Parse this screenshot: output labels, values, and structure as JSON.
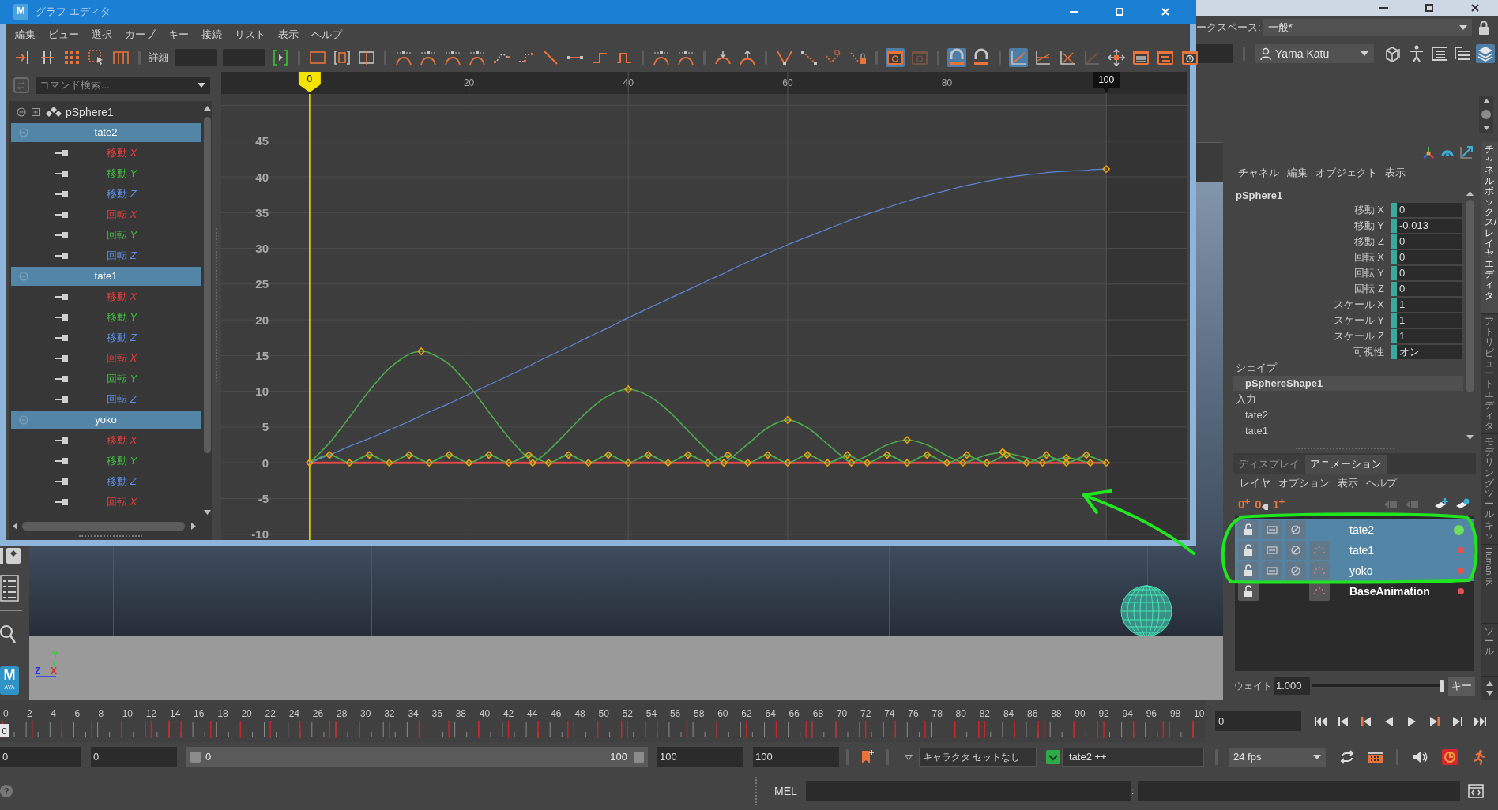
{
  "graph_editor": {
    "title": "グラフ エディタ",
    "icon_letter": "M",
    "menu": [
      "編集",
      "ビュー",
      "選択",
      "カーブ",
      "キー",
      "接続",
      "リスト",
      "表示",
      "ヘルプ"
    ],
    "toolbar": [
      {
        "kind": "icon",
        "on": false,
        "disabled": false
      },
      {
        "kind": "icon",
        "on": false,
        "disabled": false
      },
      {
        "kind": "icon",
        "on": false,
        "disabled": false
      },
      {
        "kind": "icon",
        "on": false,
        "disabled": false
      },
      {
        "kind": "icon",
        "on": false,
        "disabled": false
      },
      {
        "kind": "separator"
      },
      {
        "kind": "label",
        "text": "詳細"
      },
      {
        "kind": "field"
      },
      {
        "kind": "field"
      },
      {
        "kind": "icon",
        "on": false,
        "disabled": false
      },
      {
        "kind": "separator"
      },
      {
        "kind": "icon",
        "on": false,
        "disabled": false
      },
      {
        "kind": "icon",
        "on": false,
        "disabled": false
      },
      {
        "kind": "icon",
        "on": false,
        "disabled": false
      },
      {
        "kind": "separator"
      },
      {
        "kind": "icon",
        "on": false,
        "disabled": false
      },
      {
        "kind": "icon",
        "on": false,
        "disabled": false
      },
      {
        "kind": "icon",
        "on": false,
        "disabled": false
      },
      {
        "kind": "icon",
        "on": false,
        "disabled": false
      },
      {
        "kind": "icon",
        "on": false,
        "disabled": false
      },
      {
        "kind": "icon",
        "on": false,
        "disabled": false
      },
      {
        "kind": "icon",
        "on": false,
        "disabled": false
      },
      {
        "kind": "icon",
        "on": false,
        "disabled": false
      },
      {
        "kind": "icon",
        "on": false,
        "disabled": false
      },
      {
        "kind": "icon",
        "on": false,
        "disabled": false
      },
      {
        "kind": "separator"
      },
      {
        "kind": "icon",
        "on": false,
        "disabled": false
      },
      {
        "kind": "icon",
        "on": false,
        "disabled": false
      },
      {
        "kind": "separator"
      },
      {
        "kind": "icon",
        "on": false,
        "disabled": false
      },
      {
        "kind": "icon",
        "on": false,
        "disabled": false
      },
      {
        "kind": "separator"
      },
      {
        "kind": "icon",
        "on": false,
        "disabled": false
      },
      {
        "kind": "icon",
        "on": false,
        "disabled": false
      },
      {
        "kind": "icon",
        "on": false,
        "disabled": false
      },
      {
        "kind": "icon",
        "on": false,
        "disabled": false
      },
      {
        "kind": "separator"
      },
      {
        "kind": "icon",
        "on": true,
        "disabled": false
      },
      {
        "kind": "icon",
        "on": false,
        "disabled": true
      },
      {
        "kind": "separator"
      },
      {
        "kind": "icon",
        "on": true,
        "disabled": false
      },
      {
        "kind": "icon",
        "on": false,
        "disabled": false
      },
      {
        "kind": "separator"
      },
      {
        "kind": "icon",
        "on": true,
        "disabled": false
      },
      {
        "kind": "icon",
        "on": false,
        "disabled": false
      },
      {
        "kind": "icon",
        "on": false,
        "disabled": false
      },
      {
        "kind": "icon",
        "on": false,
        "disabled": true
      },
      {
        "kind": "icon",
        "on": false,
        "disabled": false
      },
      {
        "kind": "icon",
        "on": false,
        "disabled": false
      },
      {
        "kind": "icon",
        "on": false,
        "disabled": false
      },
      {
        "kind": "icon",
        "on": false,
        "disabled": false
      }
    ],
    "outliner": {
      "placeholder": "コマンド検索...",
      "items": [
        {
          "kind": "object",
          "label": "pSphere1",
          "expanded": true,
          "children": [
            {
              "kind": "layer",
              "label": "tate2",
              "expanded": true,
              "children": [
                {
                  "kind": "channel",
                  "label": "移動 *X*",
                  "color": "#e83c3c"
                },
                {
                  "kind": "channel",
                  "label": "移動 *Y*",
                  "color": "#3fbf3f"
                },
                {
                  "kind": "channel",
                  "label": "移動 *Z*",
                  "color": "#5a8de6"
                },
                {
                  "kind": "channel",
                  "label": "回転 *X*",
                  "color": "#e83c3c"
                },
                {
                  "kind": "channel",
                  "label": "回転 *Y*",
                  "color": "#3fbf3f"
                },
                {
                  "kind": "channel",
                  "label": "回転 *Z*",
                  "color": "#5a8de6"
                }
              ]
            },
            {
              "kind": "layer",
              "label": "tate1",
              "expanded": true,
              "children": [
                {
                  "kind": "channel",
                  "label": "移動 *X*",
                  "color": "#e83c3c"
                },
                {
                  "kind": "channel",
                  "label": "移動 *Y*",
                  "color": "#3fbf3f"
                },
                {
                  "kind": "channel",
                  "label": "移動 *Z*",
                  "color": "#5a8de6"
                },
                {
                  "kind": "channel",
                  "label": "回転 *X*",
                  "color": "#e83c3c"
                },
                {
                  "kind": "channel",
                  "label": "回転 *Y*",
                  "color": "#3fbf3f"
                },
                {
                  "kind": "channel",
                  "label": "回転 *Z*",
                  "color": "#5a8de6"
                }
              ]
            },
            {
              "kind": "layer",
              "label": "yoko",
              "expanded": true,
              "children": [
                {
                  "kind": "channel",
                  "label": "移動 *X*",
                  "color": "#e83c3c"
                },
                {
                  "kind": "channel",
                  "label": "移動 *Y*",
                  "color": "#3fbf3f"
                },
                {
                  "kind": "channel",
                  "label": "移動 *Z*",
                  "color": "#5a8de6"
                },
                {
                  "kind": "channel",
                  "label": "回転 *X*",
                  "color": "#e83c3c"
                }
              ]
            }
          ]
        }
      ]
    },
    "graph": {
      "range_end": "100",
      "chart_data": {
        "type": "line",
        "grid": true,
        "xlim": [
          -11.1,
          110.2
        ],
        "ylim": [
          -10.8,
          51.6
        ],
        "xticks": [
          20,
          40,
          60,
          80
        ],
        "yticks": [
          -10,
          -5,
          0,
          5,
          10,
          15,
          20,
          25,
          30,
          35,
          40,
          45
        ],
        "ref_lines": [
          {
            "axis": "x",
            "value": 0,
            "label": "0"
          }
        ],
        "x": [
          0,
          2.5,
          5,
          7.5,
          10,
          12.5,
          14,
          15,
          17.5,
          20,
          22.5,
          25,
          27.5,
          28,
          30,
          32.5,
          35,
          37.5,
          40,
          42.5,
          45,
          47.5,
          50,
          52,
          52.5,
          55,
          57.5,
          60,
          62.5,
          65,
          67.5,
          68,
          70,
          72.5,
          75,
          77.5,
          80,
          82,
          82.5,
          85,
          87,
          87.5,
          90,
          92,
          92.5,
          95,
          97.5,
          98,
          100
        ],
        "series": [
          {
            "color": "#5b86d9",
            "values": [
              0,
              1.1,
              2.3,
              3.4,
              4.6,
              5.8,
              6.6,
              7.1,
              8.3,
              9.6,
              10.9,
              12.2,
              13.5,
              13.8,
              14.9,
              16.2,
              17.6,
              18.9,
              20.3,
              21.6,
              22.9,
              24.2,
              25.5,
              26.5,
              26.8,
              28.1,
              29.3,
              30.5,
              31.6,
              32.7,
              33.8,
              34,
              34.8,
              35.7,
              36.6,
              37.4,
              38.1,
              38.7,
              38.8,
              39.4,
              39.8,
              39.9,
              40.3,
              40.5,
              40.6,
              40.8,
              40.9,
              41,
              41.1
            ]
          },
          {
            "color": "#4caa4c",
            "values": [
              0,
              2.8,
              6.4,
              10.1,
              13.2,
              15.2,
              15.6,
              15.4,
              13.8,
              10.8,
              7.1,
              3.5,
              0.5,
              0,
              1.7,
              4.5,
              7.3,
              9.4,
              10.3,
              9.4,
              7.3,
              4.5,
              1.7,
              0,
              0.3,
              2.6,
              4.9,
              6,
              4.9,
              2.6,
              0.3,
              0,
              1,
              2.5,
              3.2,
              2.5,
              1,
              0,
              0.1,
              1.1,
              1.5,
              1.4,
              0.7,
              0,
              0.1,
              0.7,
              0.1,
              0,
              0
            ]
          },
          {
            "color": "#4caa4c",
            "values": [
              0,
              1.1,
              0,
              1.1,
              0,
              1.1,
              0.4,
              0,
              1.1,
              0,
              1.1,
              0,
              1.1,
              0.9,
              0,
              1.1,
              0,
              1.1,
              0,
              1.1,
              0,
              1.1,
              0,
              0.9,
              1.1,
              0,
              1.1,
              0,
              1.1,
              0,
              1.1,
              0.9,
              0,
              1.1,
              0,
              1.1,
              0,
              0.9,
              1.1,
              0,
              0.9,
              1.1,
              0,
              0.9,
              1.1,
              0,
              1.1,
              0.9,
              0
            ]
          },
          {
            "color": "#e04848",
            "values": [
              0,
              0,
              0,
              0,
              0,
              0,
              0,
              0,
              0,
              0,
              0,
              0,
              0,
              0,
              0,
              0,
              0,
              0,
              0,
              0,
              0,
              0,
              0,
              0,
              0,
              0,
              0,
              0,
              0,
              0,
              0,
              0,
              0,
              0,
              0,
              0,
              0,
              0,
              0,
              0,
              0,
              0,
              0,
              0,
              0,
              0,
              0,
              0,
              0
            ]
          }
        ]
      }
    }
  },
  "main_window": {
    "workspace_label": "ークスペース:",
    "workspace": "一般*",
    "user": "Yama Katu",
    "shelf_icons": [
      {
        "on": false
      },
      {
        "on": false
      },
      {
        "on": false
      },
      {
        "on": false
      },
      {
        "on": true
      }
    ]
  },
  "viewport": {
    "axes": [
      {
        "text": "Y",
        "color": "#2ed42e"
      },
      {
        "text": "Z",
        "color": "#2233ee"
      },
      {
        "text": "X",
        "color": "#dd2424"
      }
    ],
    "logo": {
      "letter": "M",
      "caption": "AYA"
    }
  },
  "channel_box": {
    "menu": [
      "チャネル",
      "編集",
      "オブジェクト",
      "表示"
    ],
    "object": "pSphere1",
    "attributes": [
      {
        "label": "移動 X",
        "value": "0",
        "keyed": true
      },
      {
        "label": "移動 Y",
        "value": "-0.013",
        "keyed": true
      },
      {
        "label": "移動 Z",
        "value": "0",
        "keyed": true
      },
      {
        "label": "回転 X",
        "value": "0",
        "keyed": true
      },
      {
        "label": "回転 Y",
        "value": "0",
        "keyed": true
      },
      {
        "label": "回転 Z",
        "value": "0",
        "keyed": true
      },
      {
        "label": "スケール X",
        "value": "1",
        "keyed": true
      },
      {
        "label": "スケール Y",
        "value": "1",
        "keyed": true
      },
      {
        "label": "スケール Z",
        "value": "1",
        "keyed": true
      },
      {
        "label": "可視性",
        "value": "オン",
        "keyed": true
      }
    ],
    "shape_heading": "シェイプ",
    "shape": "pSphereShape1",
    "inputs_heading": "入力",
    "inputs": [
      "tate2",
      "tate1"
    ]
  },
  "layer_editor": {
    "tabs": [
      {
        "label": "ディスプレイ",
        "selected": false
      },
      {
        "label": "アニメーション",
        "selected": true
      }
    ],
    "menu": [
      "レイヤ",
      "オプション",
      "表示",
      "ヘルプ"
    ],
    "key_buttons": [
      {
        "label": "0",
        "kind": "plus"
      },
      {
        "label": "0",
        "kind": "key"
      },
      {
        "label": "1",
        "kind": "plus"
      }
    ],
    "tools": [
      {
        "disabled": true
      },
      {
        "disabled": true
      },
      {
        "disabled": false
      },
      {
        "disabled": false
      }
    ],
    "layers": [
      {
        "name": "tate2",
        "kind": "layer",
        "selected": true,
        "active": true,
        "show_weight": false,
        "color": "#6ee05a"
      },
      {
        "name": "tate1",
        "kind": "layer",
        "selected": true,
        "active": false,
        "show_weight": true,
        "color": "#e05252"
      },
      {
        "name": "yoko",
        "kind": "layer",
        "selected": true,
        "active": false,
        "show_weight": true,
        "color": "#e05252"
      },
      {
        "name": "BaseAnimation",
        "kind": "base",
        "selected": false,
        "active": false,
        "show_weight": true,
        "color": "#e05252"
      }
    ],
    "weight_label": "ウェイト",
    "weight": "1.000",
    "weight_slider": {
      "level": 1
    },
    "key_button": "キー"
  },
  "side_tabs": [
    {
      "label": "チャネルボックス/レイヤエディタ",
      "selected": true
    },
    {
      "label": "アトリビュートエディタ",
      "selected": false
    },
    {
      "label": "モデリングツールキッ",
      "selected": false
    },
    {
      "label": "Human IK",
      "selected": false
    },
    {
      "label": "ツール",
      "selected": false
    }
  ],
  "timeline": {
    "labels": [
      "0",
      "2",
      "4",
      "6",
      "8",
      "10",
      "12",
      "14",
      "16",
      "18",
      "20",
      "22",
      "24",
      "26",
      "28",
      "30",
      "32",
      "34",
      "36",
      "38",
      "40",
      "42",
      "44",
      "46",
      "48",
      "50",
      "52",
      "54",
      "56",
      "58",
      "60",
      "62",
      "64",
      "66",
      "68",
      "70",
      "72",
      "74",
      "76",
      "78",
      "80",
      "82",
      "84",
      "86",
      "88",
      "90",
      "92",
      "94",
      "96",
      "98",
      "10"
    ],
    "current_frame": "0",
    "level": 0,
    "frame_field": "0"
  },
  "range": {
    "fields": [
      "0",
      "0"
    ],
    "slider": {
      "start": "0",
      "end": "100",
      "level": 1
    },
    "end_fields": [
      "100",
      "100"
    ],
    "character_set": "キャラクタ セットなし",
    "anim_layer": "tate2 ++",
    "fps": "24 fps"
  },
  "command_line": {
    "help": "?",
    "language": "MEL",
    "separator": ":"
  },
  "annotations": [
    {
      "kind": "arrow"
    },
    {
      "kind": "loop"
    }
  ]
}
